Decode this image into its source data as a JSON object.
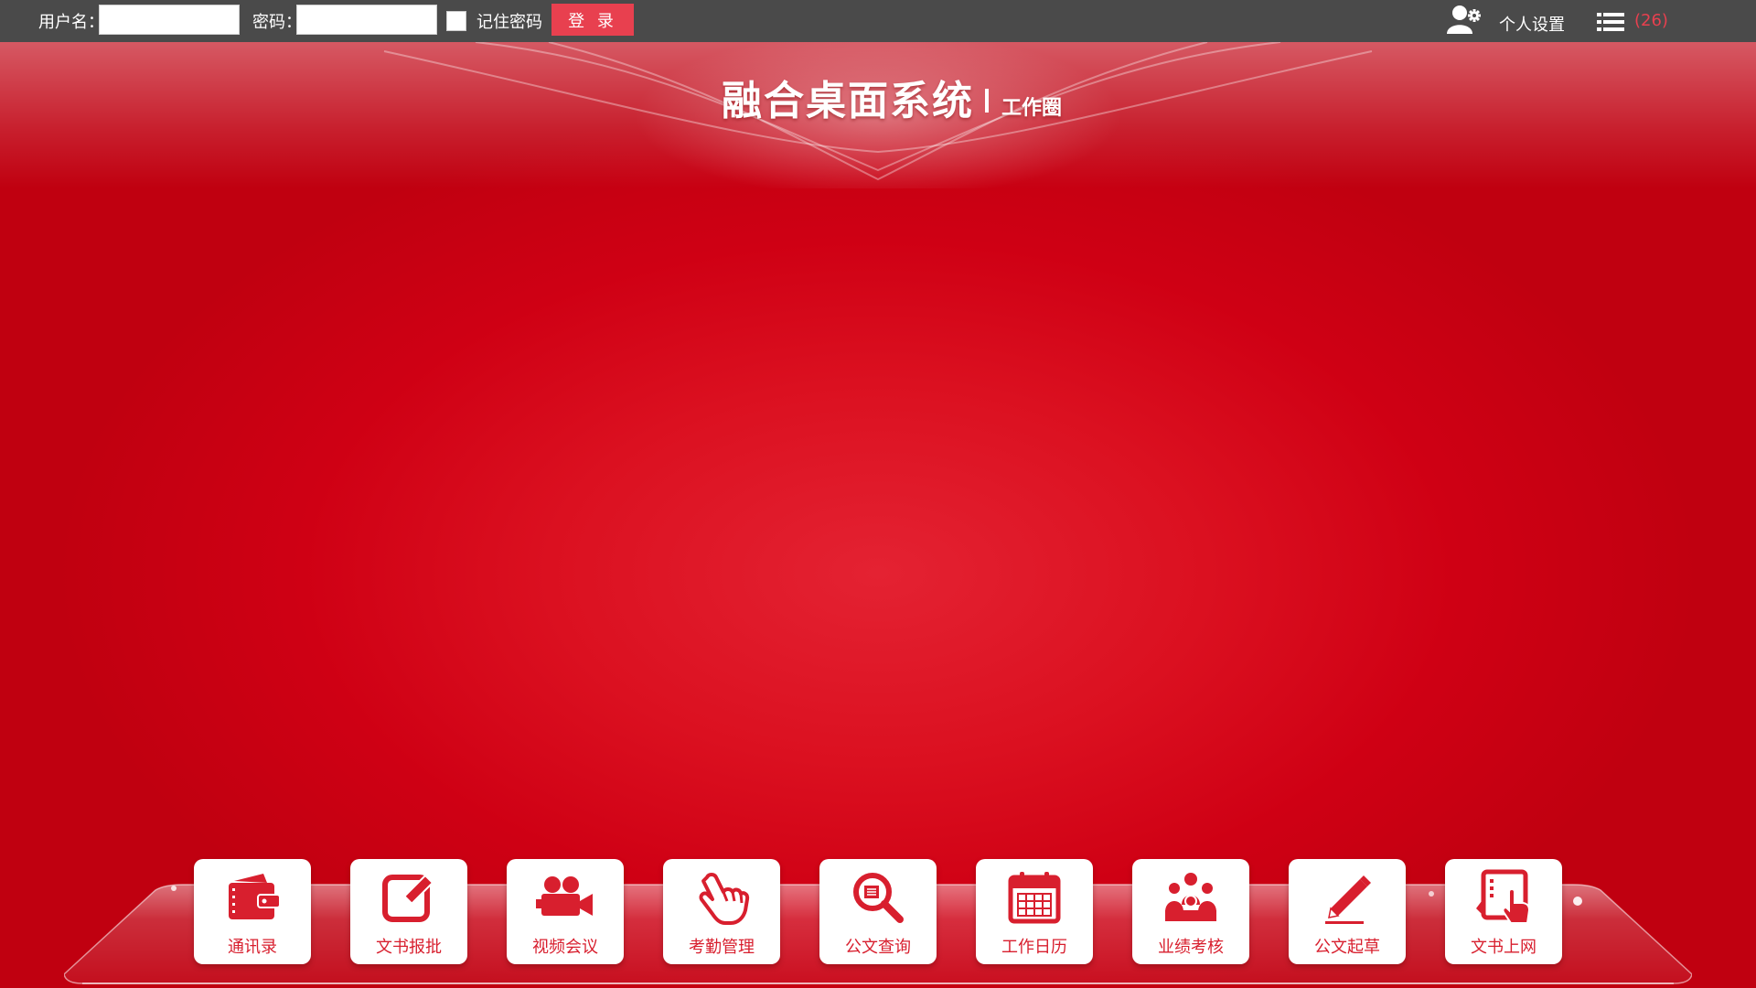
{
  "topbar": {
    "username_label": "用户名：",
    "username_value": "",
    "password_label": "密码：",
    "password_value": "",
    "remember_label": "记住密码",
    "remember_checked": false,
    "login_button": "登 录",
    "user_icon": "user-settings-icon",
    "settings_label": "个人设置",
    "menu_icon": "list-icon",
    "notification_count": "(26)"
  },
  "header": {
    "title": "融合桌面系统",
    "subtitle": "工作圈"
  },
  "dock": {
    "items": [
      {
        "label": "通讯录",
        "icon": "wallet-icon"
      },
      {
        "label": "文书报批",
        "icon": "edit-icon"
      },
      {
        "label": "视频会议",
        "icon": "video-camera-icon"
      },
      {
        "label": "考勤管理",
        "icon": "hand-pointer-icon"
      },
      {
        "label": "公文查询",
        "icon": "search-document-icon"
      },
      {
        "label": "工作日历",
        "icon": "calendar-icon"
      },
      {
        "label": "业绩考核",
        "icon": "team-icon"
      },
      {
        "label": "公文起草",
        "icon": "pencil-icon"
      },
      {
        "label": "文书上网",
        "icon": "tablet-touch-icon"
      }
    ]
  },
  "colors": {
    "background": "#d50f1e",
    "topbar": "#4a4a4a",
    "accent": "#e8404f",
    "tile_icon": "#d81f2e"
  }
}
